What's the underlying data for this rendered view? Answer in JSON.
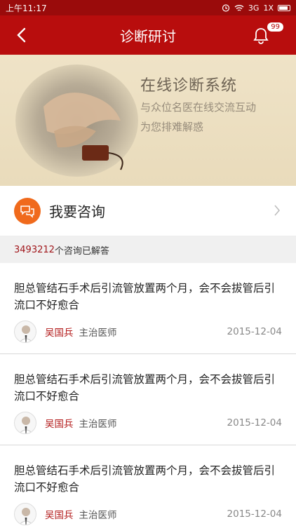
{
  "status_bar": {
    "time": "上午11:17",
    "signal": "3G",
    "carrier": "1X"
  },
  "header": {
    "title": "诊断研讨",
    "badge_count": "99"
  },
  "banner": {
    "title": "在线诊断系统",
    "line1": "与众位名医在线交流互动",
    "line2": "为您排难解惑"
  },
  "consult": {
    "label": "我要咨询"
  },
  "stats": {
    "count": "3493212",
    "suffix": "个咨询已解答"
  },
  "questions": [
    {
      "text": "胆总管结石手术后引流管放置两个月，会不会拔管后引流口不好愈合",
      "doctor": "吴国兵",
      "role": "主治医师",
      "date": "2015-12-04"
    },
    {
      "text": "胆总管结石手术后引流管放置两个月，会不会拔管后引流口不好愈合",
      "doctor": "吴国兵",
      "role": "主治医师",
      "date": "2015-12-04"
    },
    {
      "text": "胆总管结石手术后引流管放置两个月，会不会拔管后引流口不好愈合",
      "doctor": "吴国兵",
      "role": "主治医师",
      "date": "2015-12-04"
    }
  ],
  "colors": {
    "brand": "#b80d0d",
    "accent": "#f06a1c",
    "doctor_name": "#b31b1b"
  },
  "icons": [
    "back-arrow-icon",
    "bell-icon",
    "chat-icon",
    "chevron-right-icon",
    "avatar"
  ]
}
